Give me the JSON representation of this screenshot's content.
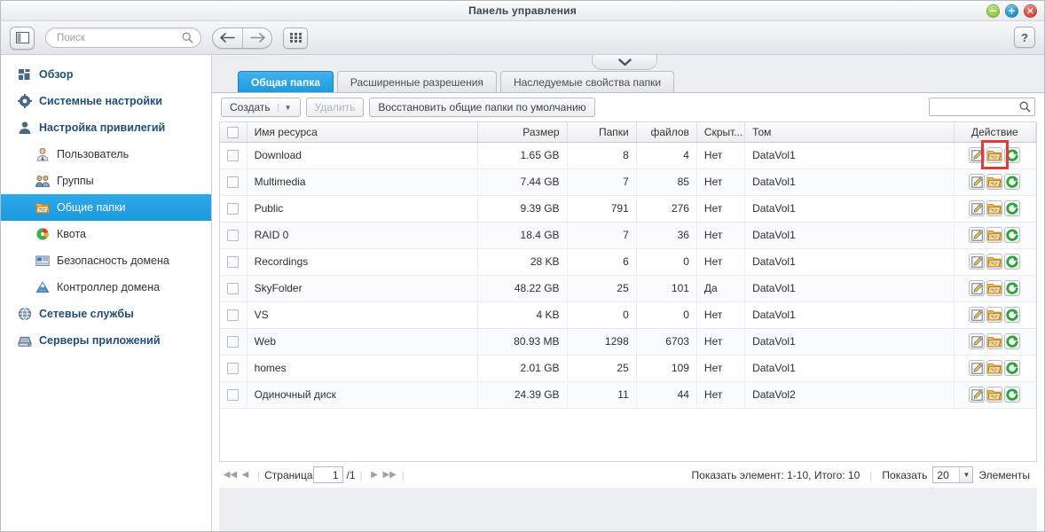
{
  "window": {
    "title": "Панель управления",
    "controls": [
      {
        "name": "minimize",
        "glyph": "−",
        "color": "#86c132"
      },
      {
        "name": "maximize",
        "glyph": "+",
        "color": "#1682c4"
      },
      {
        "name": "close",
        "glyph": "×",
        "color": "#d5372a"
      }
    ],
    "help_label": "?"
  },
  "toolbar": {
    "panel_toggle_icon": "panel-layout-icon",
    "search": {
      "value": "",
      "placeholder": "Поиск",
      "icon": "search-icon"
    },
    "back_icon": "arrow-left-icon",
    "forward_icon": "arrow-right-icon",
    "apps_icon": "grid-apps-icon"
  },
  "sidebar": {
    "items": [
      {
        "label": "Обзор",
        "icon": "overview-grid-icon",
        "level": 0,
        "selected": false
      },
      {
        "label": "Системные настройки",
        "icon": "gear-icon",
        "level": 0,
        "selected": false
      },
      {
        "label": "Настройка привилегий",
        "icon": "user-silhouette-icon",
        "level": 0,
        "selected": false
      },
      {
        "label": "Пользователь",
        "icon": "user-icon",
        "level": 1,
        "selected": false
      },
      {
        "label": "Группы",
        "icon": "group-icon",
        "level": 1,
        "selected": false
      },
      {
        "label": "Общие папки",
        "icon": "shared-folder-icon",
        "level": 1,
        "selected": true
      },
      {
        "label": "Квота",
        "icon": "quota-pie-icon",
        "level": 1,
        "selected": false
      },
      {
        "label": "Безопасность домена",
        "icon": "domain-security-icon",
        "level": 1,
        "selected": false
      },
      {
        "label": "Контроллер домена",
        "icon": "domain-controller-icon",
        "level": 1,
        "selected": false
      },
      {
        "label": "Сетевые службы",
        "icon": "globe-icon",
        "level": 0,
        "selected": false
      },
      {
        "label": "Серверы приложений",
        "icon": "server-icon",
        "level": 0,
        "selected": false
      }
    ]
  },
  "main": {
    "collapse_icon": "chevron-down-icon",
    "tabs": [
      {
        "label": "Общая папка",
        "active": true
      },
      {
        "label": "Расширенные разрешения",
        "active": false
      },
      {
        "label": "Наследуемые свойства папки",
        "active": false
      }
    ],
    "actionbar": {
      "create_label": "Создать",
      "create_caret": "▼",
      "delete_label": "Удалить",
      "restore_label": "Восстановить общие папки по умолчанию",
      "search": {
        "value": "",
        "placeholder": "",
        "icon": "search-icon"
      }
    },
    "table": {
      "columns": [
        {
          "key": "check",
          "label": "",
          "align": "center"
        },
        {
          "key": "name",
          "label": "Имя ресурса",
          "align": "left"
        },
        {
          "key": "size",
          "label": "Размер",
          "align": "right"
        },
        {
          "key": "folders",
          "label": "Папки",
          "align": "right"
        },
        {
          "key": "files",
          "label": "файлов",
          "align": "right"
        },
        {
          "key": "hidden",
          "label": "Скрыт...",
          "align": "left"
        },
        {
          "key": "volume",
          "label": "Том",
          "align": "left"
        },
        {
          "key": "action",
          "label": "Действие",
          "align": "center"
        }
      ],
      "rows": [
        {
          "name": "Download",
          "size": "1.65 GB",
          "folders": "8",
          "files": "4",
          "hidden": "Нет",
          "volume": "DataVol1"
        },
        {
          "name": "Multimedia",
          "size": "7.44 GB",
          "folders": "7",
          "files": "85",
          "hidden": "Нет",
          "volume": "DataVol1"
        },
        {
          "name": "Public",
          "size": "9.39 GB",
          "folders": "791",
          "files": "276",
          "hidden": "Нет",
          "volume": "DataVol1"
        },
        {
          "name": "RAID 0",
          "size": "18.4 GB",
          "folders": "7",
          "files": "36",
          "hidden": "Нет",
          "volume": "DataVol1"
        },
        {
          "name": "Recordings",
          "size": "28 KB",
          "folders": "6",
          "files": "0",
          "hidden": "Нет",
          "volume": "DataVol1"
        },
        {
          "name": "SkyFolder",
          "size": "48.22 GB",
          "folders": "25",
          "files": "101",
          "hidden": "Да",
          "volume": "DataVol1"
        },
        {
          "name": "VS",
          "size": "4 KB",
          "folders": "0",
          "files": "0",
          "hidden": "Нет",
          "volume": "DataVol1"
        },
        {
          "name": "Web",
          "size": "80.93 MB",
          "folders": "1298",
          "files": "6703",
          "hidden": "Нет",
          "volume": "DataVol1"
        },
        {
          "name": "homes",
          "size": "2.01 GB",
          "folders": "25",
          "files": "109",
          "hidden": "Нет",
          "volume": "DataVol1"
        },
        {
          "name": "Одиночный диск",
          "size": "24.39 GB",
          "folders": "11",
          "files": "44",
          "hidden": "Нет",
          "volume": "DataVol2"
        }
      ],
      "row_action_icons": [
        "edit-pencil-icon",
        "shared-folder-icon",
        "refresh-restore-icon"
      ]
    },
    "pager": {
      "first_icon": "first-page-icon",
      "prev_icon": "prev-page-icon",
      "page_label": "Страница",
      "page_value": "1",
      "page_total": "/1",
      "next_icon": "next-page-icon",
      "last_icon": "last-page-icon",
      "status": "Показать элемент: 1-10, Итого: 10",
      "show_label": "Показать",
      "page_size": "20",
      "page_size_caret": "▼",
      "items_label": "Элементы"
    }
  },
  "highlight": {
    "name": "shared-folder-action-highlight",
    "color": "#e03a3a"
  }
}
